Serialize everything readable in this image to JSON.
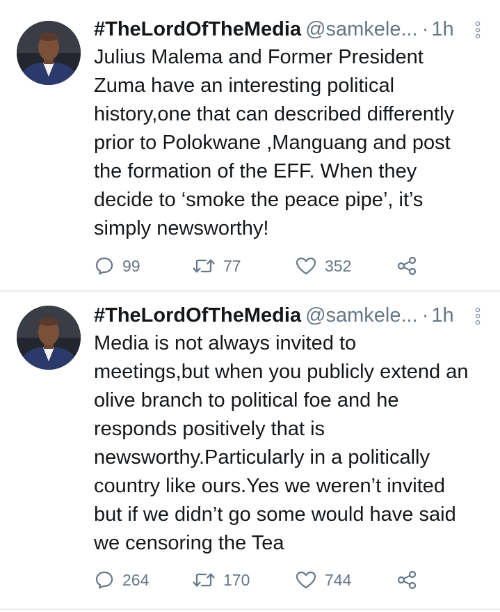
{
  "tweets": [
    {
      "author_name": "#TheLordOfTheMedia",
      "handle": "@samkele...",
      "separator": "·",
      "time": "1h",
      "text": "Julius Malema and Former President\nZuma have an interesting political\nhistory,one that can described differently\nprior to Polokwane ,Manguang and post\nthe formation of the EFF. When they\ndecide to ‘smoke the peace pipe’, it’s\nsimply newsworthy!",
      "replies": "99",
      "retweets": "77",
      "likes": "352"
    },
    {
      "author_name": "#TheLordOfTheMedia",
      "handle": "@samkele...",
      "separator": "·",
      "time": "1h",
      "text": "Media is not always invited to\nmeetings,but when you publicly extend an\nolive branch to political foe and he\nresponds positively that is\nnewsworthy.Particularly in a politically\ncountry like ours.Yes we weren’t invited\nbut if we didn’t go some would have said\nwe censoring the Tea",
      "replies": "264",
      "retweets": "170",
      "likes": "744"
    }
  ],
  "icons": {
    "reply": "reply-icon",
    "retweet": "retweet-icon",
    "like": "heart-icon",
    "share": "share-icon",
    "more": "more-vertical-icon"
  },
  "colors": {
    "text": "#14171a",
    "secondary": "#657786",
    "divider": "#e6ecf0"
  }
}
